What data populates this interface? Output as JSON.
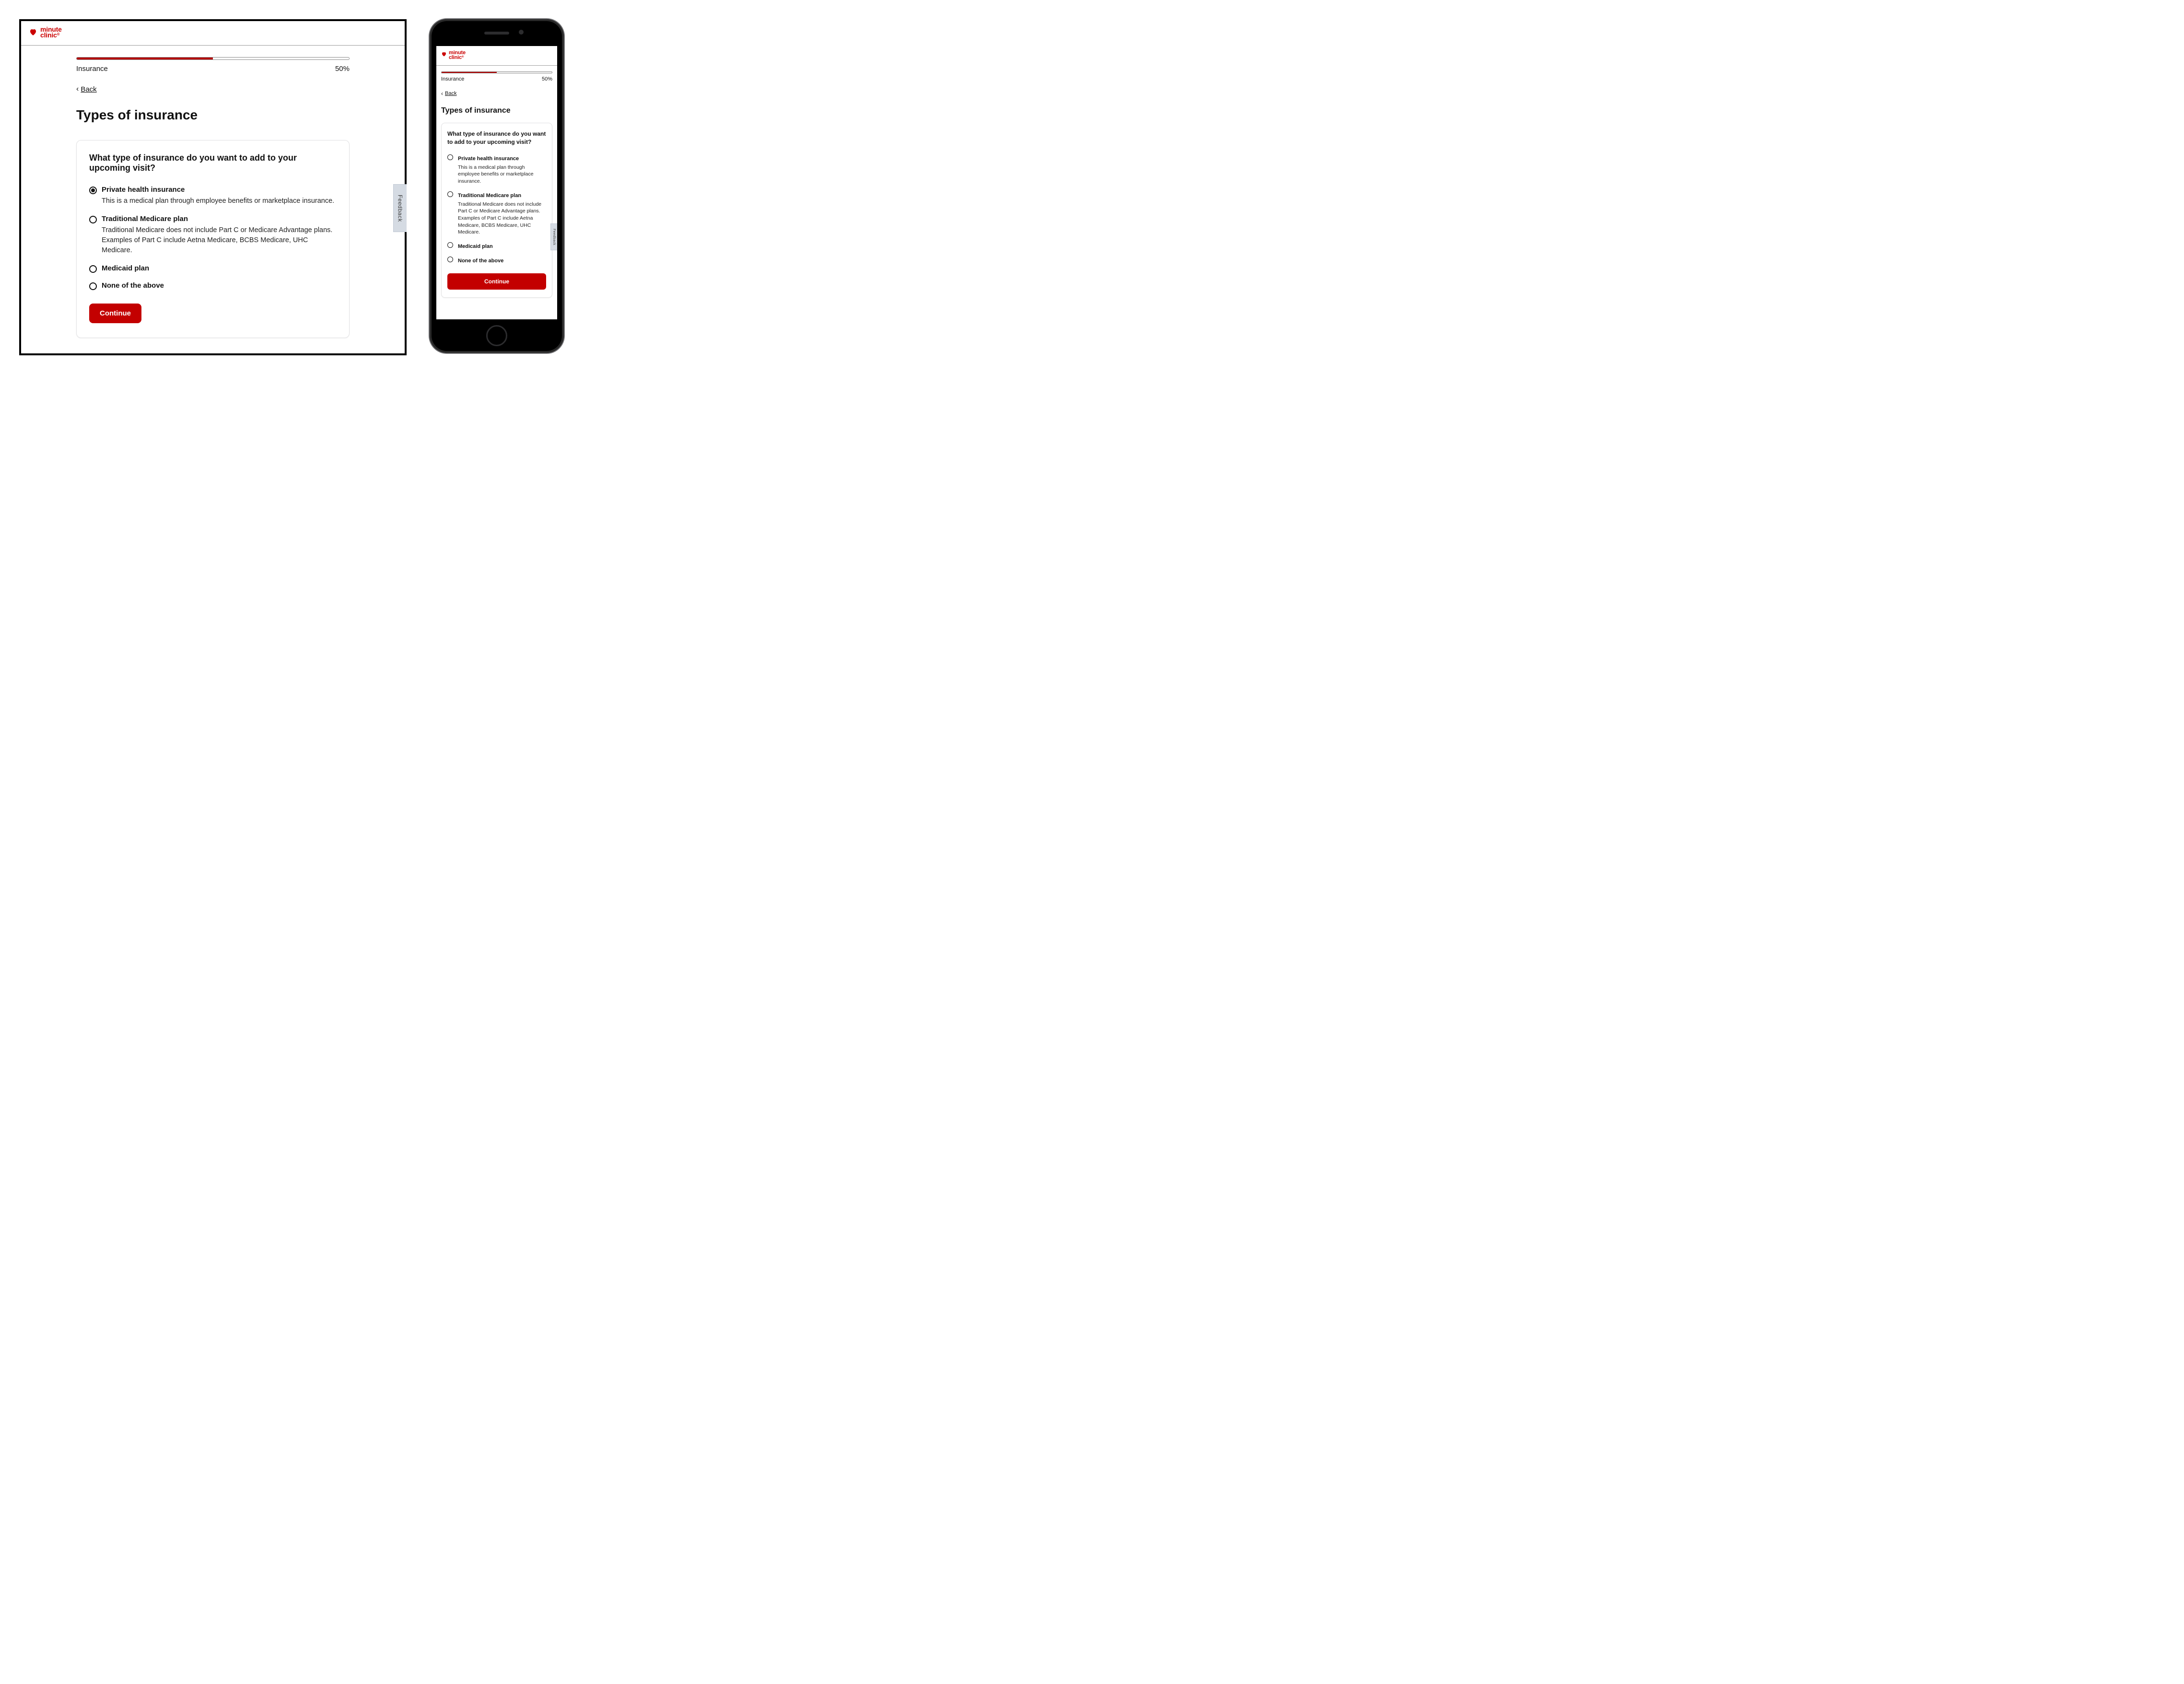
{
  "brand": {
    "line1": "minute",
    "line2": "clinic"
  },
  "colors": {
    "brand": "#cb0000",
    "primary_button": "#c30000"
  },
  "progress": {
    "label": "Insurance",
    "percent": 50,
    "percent_label": "50%"
  },
  "back": {
    "label": "Back"
  },
  "page": {
    "title": "Types of insurance"
  },
  "form": {
    "question": "What type of insurance do you want to add to your upcoming visit?",
    "options": [
      {
        "label": "Private health insurance",
        "desc": "This is a medical plan through employee benefits or marketplace insurance.",
        "selected_desktop": true,
        "selected_mobile": false
      },
      {
        "label": "Traditional Medicare plan",
        "desc": "Traditional Medicare does not include Part C or Medicare Advantage plans. Examples of Part C include Aetna Medicare, BCBS Medicare, UHC Medicare.",
        "selected_desktop": false,
        "selected_mobile": false
      },
      {
        "label": "Medicaid plan",
        "desc": "",
        "selected_desktop": false,
        "selected_mobile": false
      },
      {
        "label": "None of the above",
        "desc": "",
        "selected_desktop": false,
        "selected_mobile": false
      }
    ],
    "continue_label": "Continue"
  },
  "feedback": {
    "label": "Feedback"
  }
}
